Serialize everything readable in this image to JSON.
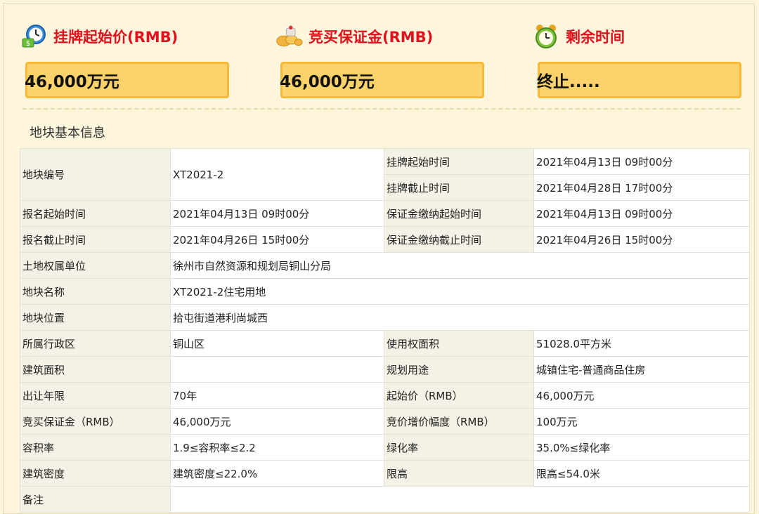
{
  "stats": {
    "start_price": {
      "icon": "clock-money-icon",
      "label": "挂牌起始价(RMB)",
      "value": "46,000万元"
    },
    "deposit": {
      "icon": "gold-coins-icon",
      "label": "竞买保证金(RMB)",
      "value": "46,000万元"
    },
    "remaining_time": {
      "icon": "alarm-clock-icon",
      "label": "剩余时间",
      "value": "终止....."
    }
  },
  "section_title": "地块基本信息",
  "table": {
    "parcel_no_label": "地块编号",
    "parcel_no": "XT2021-2",
    "listing_start_label": "挂牌起始时间",
    "listing_start": "2021年04月13日 09时00分",
    "listing_end_label": "挂牌截止时间",
    "listing_end": "2021年04月28日 17时00分",
    "signup_start_label": "报名起始时间",
    "signup_start": "2021年04月13日 09时00分",
    "deposit_start_label": "保证金缴纳起始时间",
    "deposit_start": "2021年04月13日 09时00分",
    "signup_end_label": "报名截止时间",
    "signup_end": "2021年04月26日 15时00分",
    "deposit_end_label": "保证金缴纳截止时间",
    "deposit_end": "2021年04月26日 15时00分",
    "owner_label": "土地权属单位",
    "owner": "徐州市自然资源和规划局铜山分局",
    "name_label": "地块名称",
    "name": "XT2021-2住宅用地",
    "location_label": "地块位置",
    "location": "拾屯街道港利尚城西",
    "district_label": "所属行政区",
    "district": "铜山区",
    "use_area_label": "使用权面积",
    "use_area": "51028.0平方米",
    "building_area_label": "建筑面积",
    "building_area": "",
    "planned_use_label": "规划用途",
    "planned_use": "城镇住宅-普通商品住房",
    "term_label": "出让年限",
    "term": "70年",
    "start_price_label": "起始价（RMB）",
    "start_price": "46,000万元",
    "deposit_label": "竞买保证金（RMB）",
    "deposit": "46,000万元",
    "increment_label": "竞价增价幅度（RMB）",
    "increment": "100万元",
    "far_label": "容积率",
    "far": "1.9≤容积率≤2.2",
    "green_label": "绿化率",
    "green": "35.0%≤绿化率",
    "density_label": "建筑密度",
    "density": "建筑密度≤22.0%",
    "height_label": "限高",
    "height": "限高≤54.0米",
    "remarks_label": "备注",
    "remarks": ""
  }
}
